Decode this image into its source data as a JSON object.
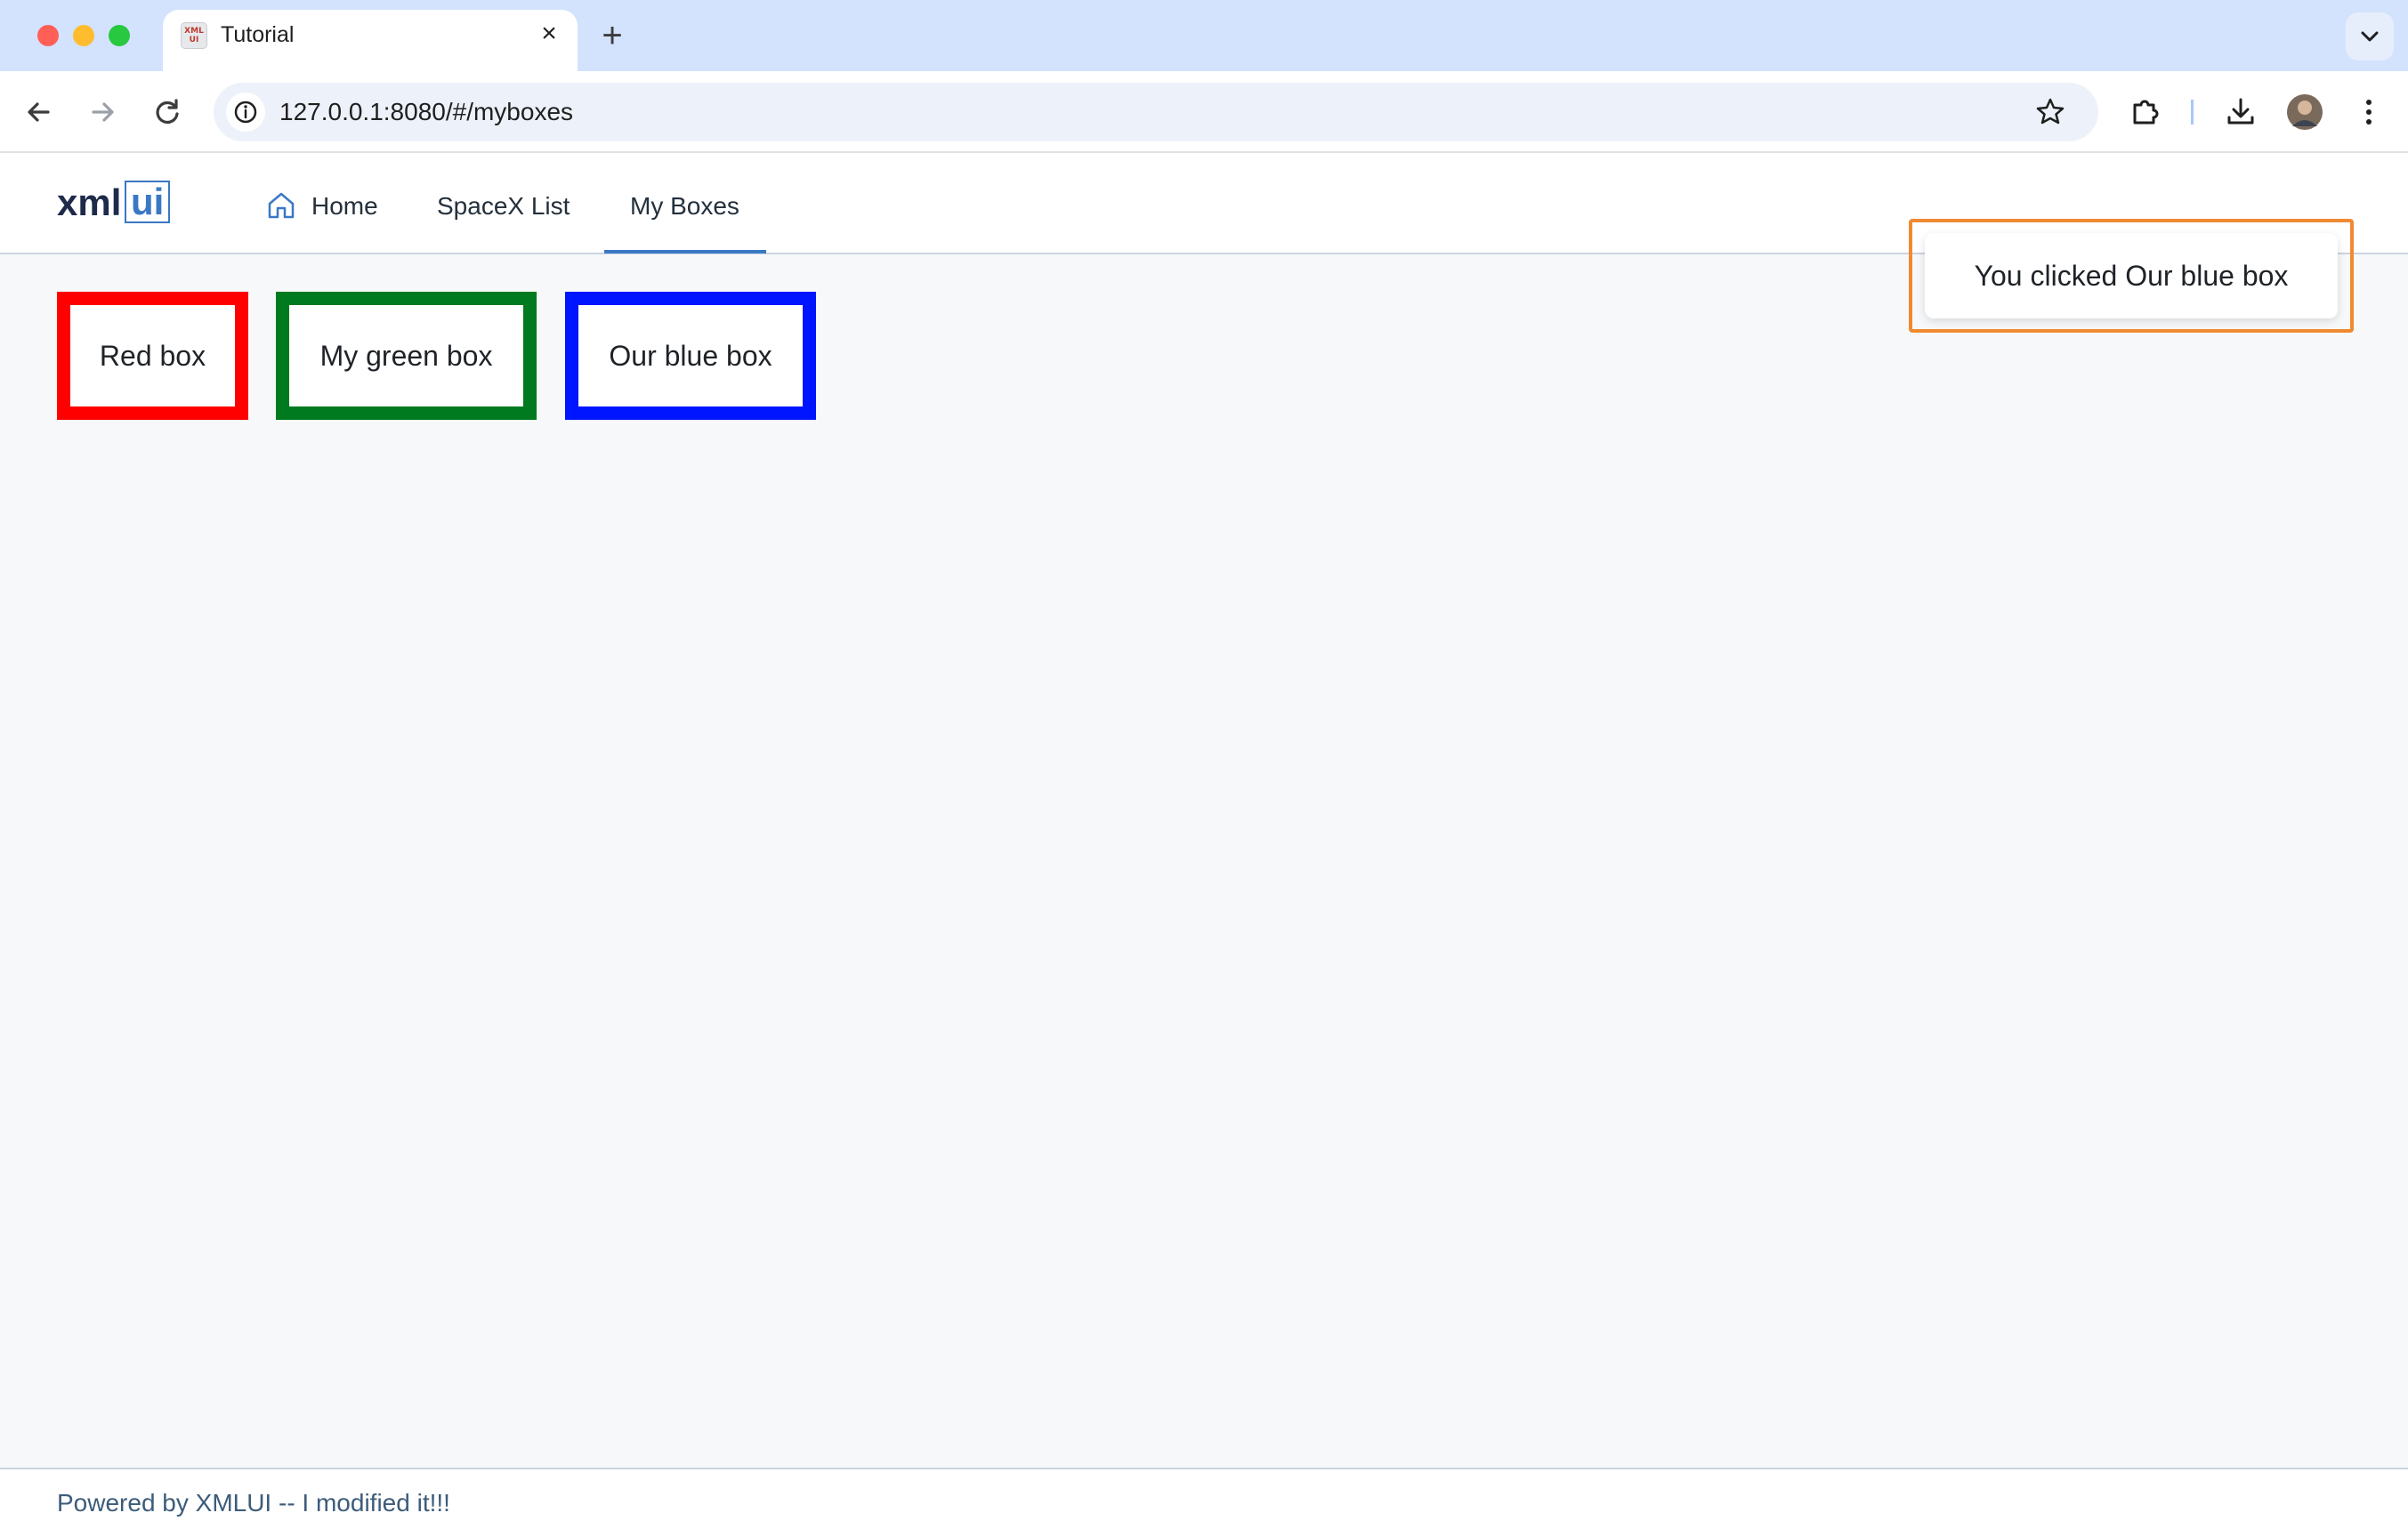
{
  "browser": {
    "tab": {
      "favicon_text": "XML UI",
      "title": "Tutorial"
    },
    "address": {
      "url": "127.0.0.1:8080/#/myboxes"
    }
  },
  "app": {
    "logo": {
      "left": "xml",
      "right": "ui"
    },
    "nav": [
      {
        "label": "Home",
        "icon": "home-icon"
      },
      {
        "label": "SpaceX List"
      },
      {
        "label": "My Boxes",
        "active": true
      }
    ],
    "boxes": [
      {
        "label": "Red box",
        "color": "#ff0000"
      },
      {
        "label": "My green box",
        "color": "#007a1f"
      },
      {
        "label": "Our blue box",
        "color": "#0015ff"
      }
    ],
    "toast": {
      "message": "You clicked Our blue box"
    },
    "footer": {
      "text": "Powered by XMLUI -- I modified it!!!"
    }
  },
  "colors": {
    "tabbar_bg": "#d3e3fd",
    "accent": "#3a78c4",
    "toast_highlight": "#f08a32",
    "traffic_close": "#ff5f57",
    "traffic_min": "#febc2e",
    "traffic_max": "#28c840"
  }
}
